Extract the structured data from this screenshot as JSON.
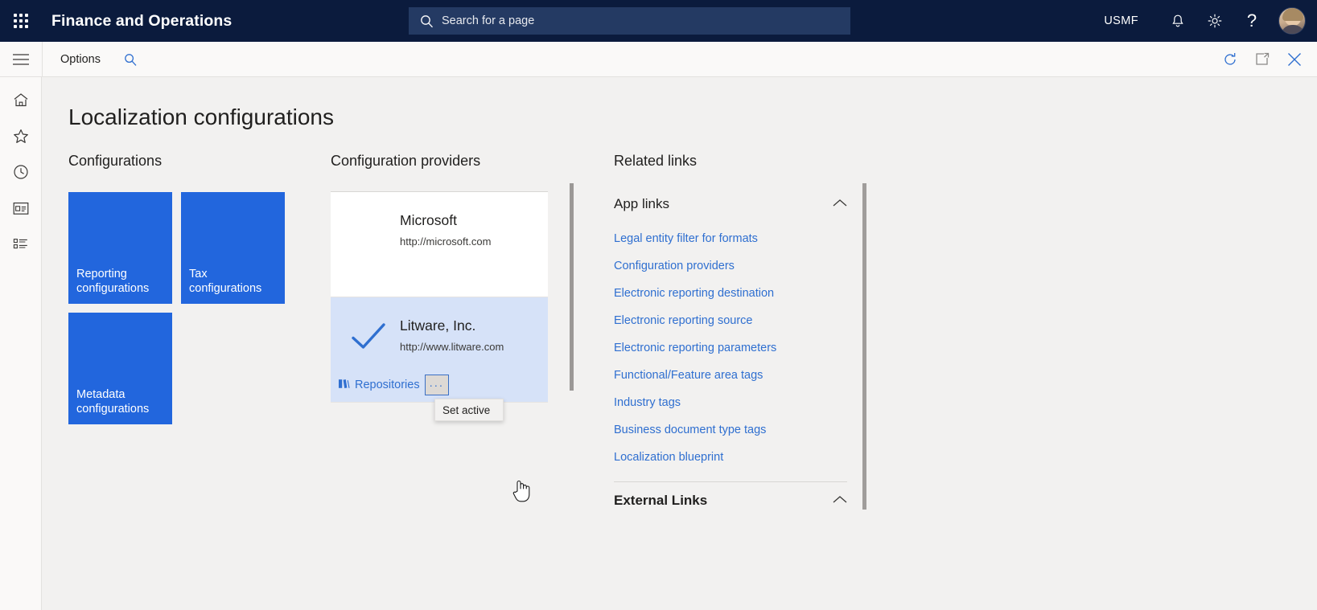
{
  "topbar": {
    "waffle_icon": "app-launcher-icon",
    "app_title": "Finance and Operations",
    "search": {
      "placeholder": "Search for a page",
      "icon": "search-icon"
    },
    "company": "USMF",
    "notifications_icon": "bell-icon",
    "settings_icon": "gear-icon",
    "help_icon": "question-mark-icon",
    "avatar": "user-avatar"
  },
  "cmdbar": {
    "hamburger_icon": "hamburger-menu-icon",
    "options_label": "Options",
    "search_icon": "search-icon",
    "refresh_icon": "refresh-icon",
    "popout_icon": "open-in-new-window-icon",
    "close_icon": "close-icon"
  },
  "rail": {
    "items": [
      {
        "icon": "home-icon",
        "name": "home"
      },
      {
        "icon": "star-icon",
        "name": "favorites"
      },
      {
        "icon": "clock-icon",
        "name": "recent"
      },
      {
        "icon": "workspace-icon",
        "name": "workspaces"
      },
      {
        "icon": "modules-list-icon",
        "name": "modules"
      }
    ]
  },
  "page": {
    "title": "Localization configurations"
  },
  "configurations": {
    "heading": "Configurations",
    "tiles": [
      {
        "label": "Reporting configurations"
      },
      {
        "label": "Tax configurations"
      },
      {
        "label": "Metadata configurations"
      }
    ],
    "tile_color": "#2266dd"
  },
  "providers": {
    "heading": "Configuration providers",
    "cards": [
      {
        "name": "Microsoft",
        "url": "http://microsoft.com",
        "selected": false,
        "active": false
      },
      {
        "name": "Litware, Inc.",
        "url": "http://www.litware.com",
        "selected": true,
        "active": true,
        "repositories_label": "Repositories",
        "ellipsis_label": "···"
      }
    ],
    "context_menu": {
      "items": [
        "Set active"
      ]
    }
  },
  "related": {
    "heading": "Related links",
    "groups": [
      {
        "title": "App links",
        "expanded": true,
        "chevron": "chevron-up-icon",
        "links": [
          "Legal entity filter for formats",
          "Configuration providers",
          "Electronic reporting destination",
          "Electronic reporting source",
          "Electronic reporting parameters",
          "Functional/Feature area tags",
          "Industry tags",
          "Business document type tags",
          "Localization blueprint"
        ]
      },
      {
        "title": "External Links",
        "expanded": true,
        "chevron": "chevron-up-icon",
        "links": []
      }
    ]
  },
  "colors": {
    "nav_bar": "#0b1b3d",
    "accent_link": "#2f6fd0",
    "tile_blue": "#2266dd",
    "selected_card": "#d6e2f8",
    "page_bg": "#f2f1f0"
  }
}
